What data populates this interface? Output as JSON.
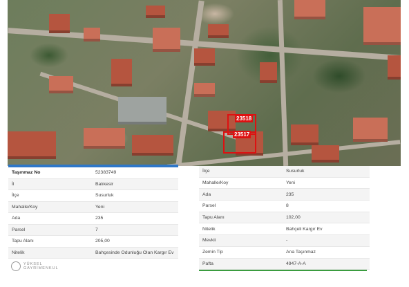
{
  "map": {
    "parcel_labels": [
      "23518",
      "23517"
    ]
  },
  "left_table": {
    "rows": [
      {
        "key": "Taşınmaz No",
        "value": "52383749"
      },
      {
        "key": "İl",
        "value": "Balıkesir"
      },
      {
        "key": "İlçe",
        "value": "Susurluk"
      },
      {
        "key": "Mahalle/Koy",
        "value": "Yeni"
      },
      {
        "key": "Ada",
        "value": "235"
      },
      {
        "key": "Parsel",
        "value": "7"
      },
      {
        "key": "Tapu Alanı",
        "value": "205,00"
      },
      {
        "key": "Nitelik",
        "value": "Bahçesinde Odunluğu Olan Kargır Ev"
      }
    ]
  },
  "right_table": {
    "rows": [
      {
        "key": "İlçe",
        "value": "Susurluk"
      },
      {
        "key": "Mahalle/Koy",
        "value": "Yeni"
      },
      {
        "key": "Ada",
        "value": "235"
      },
      {
        "key": "Parsel",
        "value": "8"
      },
      {
        "key": "Tapu Alanı",
        "value": "102,00"
      },
      {
        "key": "Nitelik",
        "value": "Bahçeli Kargır Ev"
      },
      {
        "key": "Mevkii",
        "value": "-"
      },
      {
        "key": "Zemin Tip",
        "value": "Ana Taşınmaz"
      },
      {
        "key": "Pafta",
        "value": "4947-A-A"
      }
    ]
  },
  "logo": {
    "line1": "YÜKSEL",
    "line2": "GAYRİMENKUL"
  }
}
